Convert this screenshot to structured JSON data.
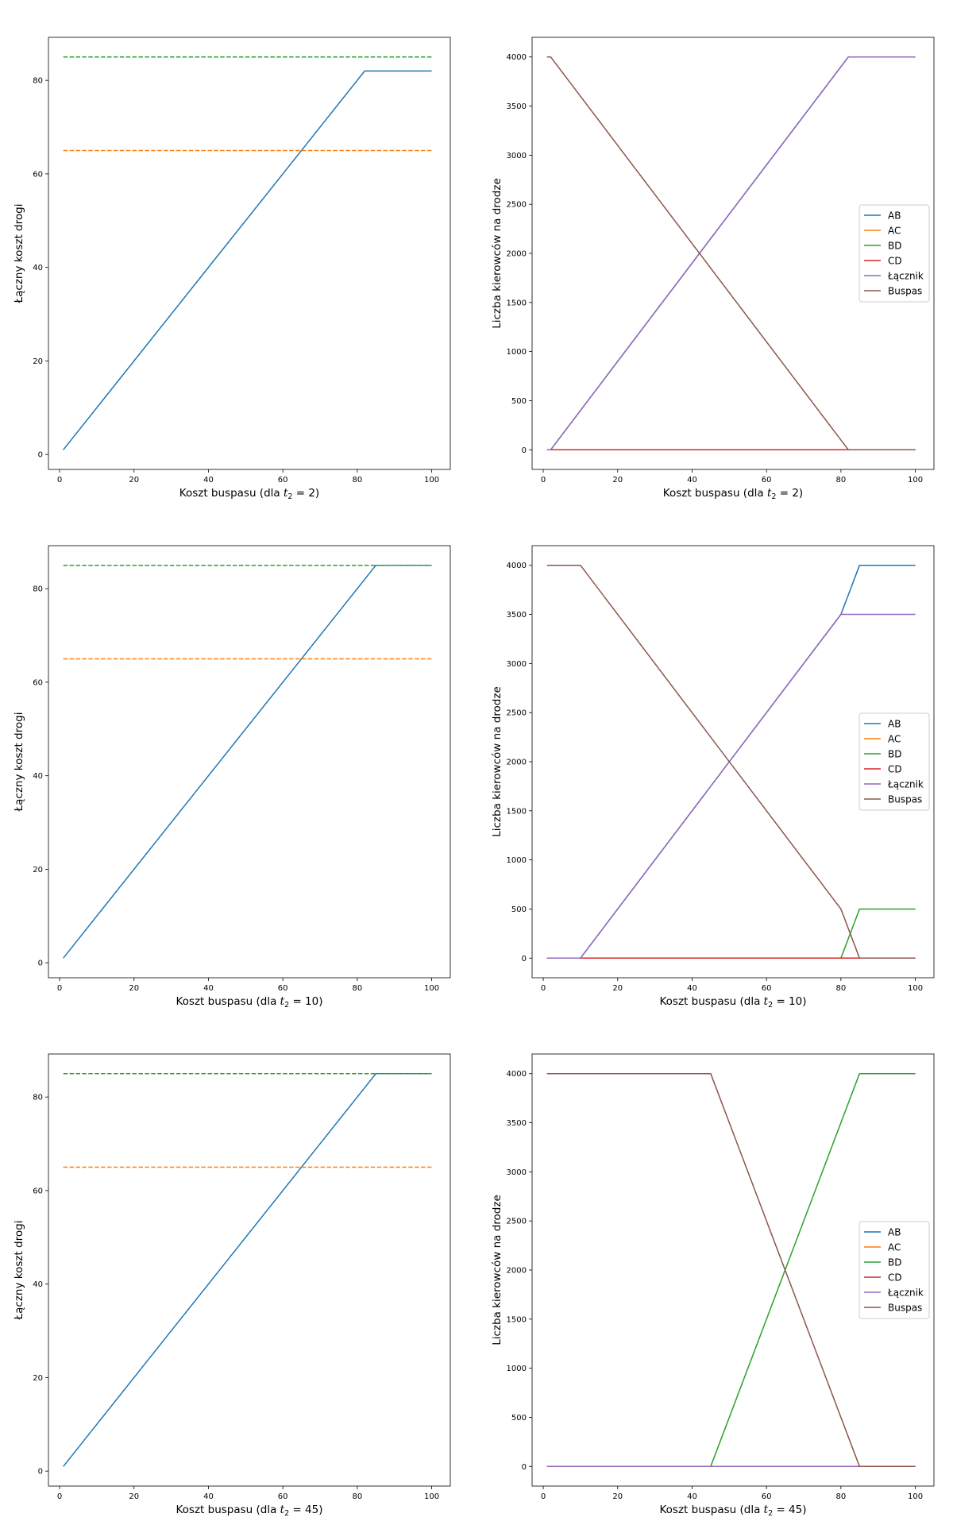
{
  "figure": {
    "subplot_rows": 3,
    "subplot_cols": 2,
    "colors": {
      "AB": "#1f77b4",
      "AC": "#ff7f0e",
      "BD": "#2ca02c",
      "CD": "#d62728",
      "Łącznik": "#9467bd",
      "Buspas": "#8c564b"
    }
  },
  "chart_data": [
    {
      "type": "line",
      "row": 0,
      "col": 0,
      "xlabel": "Koszt buspasu (dla ",
      "xlabel_t": "t",
      "xlabel_sub": "2",
      "xlabel_rest": " = 2)",
      "ylabel": "Łączny koszt drogi",
      "xlim": [
        -3,
        105
      ],
      "ylim": [
        -3.2,
        89.2
      ],
      "xticks": [
        0,
        20,
        40,
        60,
        80,
        100
      ],
      "yticks": [
        0,
        20,
        40,
        60,
        80
      ],
      "grid": false,
      "series": [
        {
          "x": [
            1,
            82,
            100
          ],
          "y": [
            1,
            82,
            82
          ],
          "color": "#1f77b4",
          "dash": false
        },
        {
          "x": [
            1,
            100
          ],
          "y": [
            65,
            65
          ],
          "color": "#ff7f0e",
          "dash": true
        },
        {
          "x": [
            1,
            100
          ],
          "y": [
            85,
            85
          ],
          "color": "#2ca02c",
          "dash": true
        }
      ]
    },
    {
      "type": "line",
      "row": 0,
      "col": 1,
      "xlabel": "Koszt buspasu (dla ",
      "xlabel_t": "t",
      "xlabel_sub": "2",
      "xlabel_rest": " = 2)",
      "ylabel": "Liczba kierowców na drodze",
      "xlim": [
        -3,
        105
      ],
      "ylim": [
        -200,
        4200
      ],
      "xticks": [
        0,
        20,
        40,
        60,
        80,
        100
      ],
      "yticks": [
        0,
        500,
        1000,
        1500,
        2000,
        2500,
        3000,
        3500,
        4000
      ],
      "grid": false,
      "legend_position": "center-right",
      "series": [
        {
          "name": "AB",
          "x": [
            1,
            2,
            82,
            100
          ],
          "y": [
            0,
            0,
            4000,
            4000
          ],
          "color": "#1f77b4"
        },
        {
          "name": "AC",
          "x": [
            1,
            100
          ],
          "y": [
            0,
            0
          ],
          "color": "#ff7f0e"
        },
        {
          "name": "BD",
          "x": [
            1,
            100
          ],
          "y": [
            0,
            0
          ],
          "color": "#2ca02c"
        },
        {
          "name": "CD",
          "x": [
            1,
            100
          ],
          "y": [
            0,
            0
          ],
          "color": "#d62728"
        },
        {
          "name": "Łącznik",
          "x": [
            1,
            2,
            82,
            100
          ],
          "y": [
            0,
            0,
            4000,
            4000
          ],
          "color": "#9467bd"
        },
        {
          "name": "Buspas",
          "x": [
            1,
            2,
            82,
            100
          ],
          "y": [
            4000,
            4000,
            0,
            0
          ],
          "color": "#8c564b"
        }
      ]
    },
    {
      "type": "line",
      "row": 1,
      "col": 0,
      "xlabel": "Koszt buspasu (dla ",
      "xlabel_t": "t",
      "xlabel_sub": "2",
      "xlabel_rest": " = 10)",
      "ylabel": "Łączny koszt drogi",
      "xlim": [
        -3,
        105
      ],
      "ylim": [
        -3.2,
        89.2
      ],
      "xticks": [
        0,
        20,
        40,
        60,
        80,
        100
      ],
      "yticks": [
        0,
        20,
        40,
        60,
        80
      ],
      "grid": false,
      "series": [
        {
          "x": [
            1,
            85,
            100
          ],
          "y": [
            1,
            85,
            85
          ],
          "color": "#1f77b4",
          "dash": false
        },
        {
          "x": [
            1,
            100
          ],
          "y": [
            65,
            65
          ],
          "color": "#ff7f0e",
          "dash": true
        },
        {
          "x": [
            1,
            100
          ],
          "y": [
            85,
            85
          ],
          "color": "#2ca02c",
          "dash": true
        }
      ]
    },
    {
      "type": "line",
      "row": 1,
      "col": 1,
      "xlabel": "Koszt buspasu (dla ",
      "xlabel_t": "t",
      "xlabel_sub": "2",
      "xlabel_rest": " = 10)",
      "ylabel": "Liczba kierowców na drodze",
      "xlim": [
        -3,
        105
      ],
      "ylim": [
        -200,
        4200
      ],
      "xticks": [
        0,
        20,
        40,
        60,
        80,
        100
      ],
      "yticks": [
        0,
        500,
        1000,
        1500,
        2000,
        2500,
        3000,
        3500,
        4000
      ],
      "grid": false,
      "legend_position": "center-right",
      "series": [
        {
          "name": "AB",
          "x": [
            1,
            10,
            80,
            85,
            100
          ],
          "y": [
            0,
            0,
            3500,
            4000,
            4000
          ],
          "color": "#1f77b4"
        },
        {
          "name": "AC",
          "x": [
            1,
            100
          ],
          "y": [
            0,
            0
          ],
          "color": "#ff7f0e"
        },
        {
          "name": "BD",
          "x": [
            1,
            80,
            85,
            100
          ],
          "y": [
            0,
            0,
            500,
            500
          ],
          "color": "#2ca02c"
        },
        {
          "name": "CD",
          "x": [
            1,
            100
          ],
          "y": [
            0,
            0
          ],
          "color": "#d62728"
        },
        {
          "name": "Łącznik",
          "x": [
            1,
            10,
            80,
            100
          ],
          "y": [
            0,
            0,
            3500,
            3500
          ],
          "color": "#9467bd"
        },
        {
          "name": "Buspas",
          "x": [
            1,
            10,
            80,
            85,
            100
          ],
          "y": [
            4000,
            4000,
            500,
            0,
            0
          ],
          "color": "#8c564b"
        }
      ]
    },
    {
      "type": "line",
      "row": 2,
      "col": 0,
      "xlabel": "Koszt buspasu (dla ",
      "xlabel_t": "t",
      "xlabel_sub": "2",
      "xlabel_rest": " = 45)",
      "ylabel": "Łączny koszt drogi",
      "xlim": [
        -3,
        105
      ],
      "ylim": [
        -3.2,
        89.2
      ],
      "xticks": [
        0,
        20,
        40,
        60,
        80,
        100
      ],
      "yticks": [
        0,
        20,
        40,
        60,
        80
      ],
      "grid": false,
      "series": [
        {
          "x": [
            1,
            85,
            100
          ],
          "y": [
            1,
            85,
            85
          ],
          "color": "#1f77b4",
          "dash": false
        },
        {
          "x": [
            1,
            100
          ],
          "y": [
            65,
            65
          ],
          "color": "#ff7f0e",
          "dash": true
        },
        {
          "x": [
            1,
            100
          ],
          "y": [
            85,
            85
          ],
          "color": "#2ca02c",
          "dash": true
        }
      ]
    },
    {
      "type": "line",
      "row": 2,
      "col": 1,
      "xlabel": "Koszt buspasu (dla ",
      "xlabel_t": "t",
      "xlabel_sub": "2",
      "xlabel_rest": " = 45)",
      "ylabel": "Liczba kierowców na drodze",
      "xlim": [
        -3,
        105
      ],
      "ylim": [
        -200,
        4200
      ],
      "xticks": [
        0,
        20,
        40,
        60,
        80,
        100
      ],
      "yticks": [
        0,
        500,
        1000,
        1500,
        2000,
        2500,
        3000,
        3500,
        4000
      ],
      "grid": false,
      "legend_position": "center-right",
      "series": [
        {
          "name": "AB",
          "x": [
            1,
            100
          ],
          "y": [
            0,
            0
          ],
          "color": "#1f77b4"
        },
        {
          "name": "AC",
          "x": [
            1,
            100
          ],
          "y": [
            0,
            0
          ],
          "color": "#ff7f0e"
        },
        {
          "name": "BD",
          "x": [
            1,
            45,
            85,
            100
          ],
          "y": [
            0,
            0,
            4000,
            4000
          ],
          "color": "#2ca02c"
        },
        {
          "name": "CD",
          "x": [
            1,
            100
          ],
          "y": [
            0,
            0
          ],
          "color": "#d62728"
        },
        {
          "name": "Łącznik",
          "x": [
            1,
            100
          ],
          "y": [
            0,
            0
          ],
          "color": "#9467bd"
        },
        {
          "name": "Buspas",
          "x": [
            1,
            45,
            85,
            100
          ],
          "y": [
            4000,
            4000,
            0,
            0
          ],
          "color": "#8c564b"
        }
      ]
    }
  ]
}
